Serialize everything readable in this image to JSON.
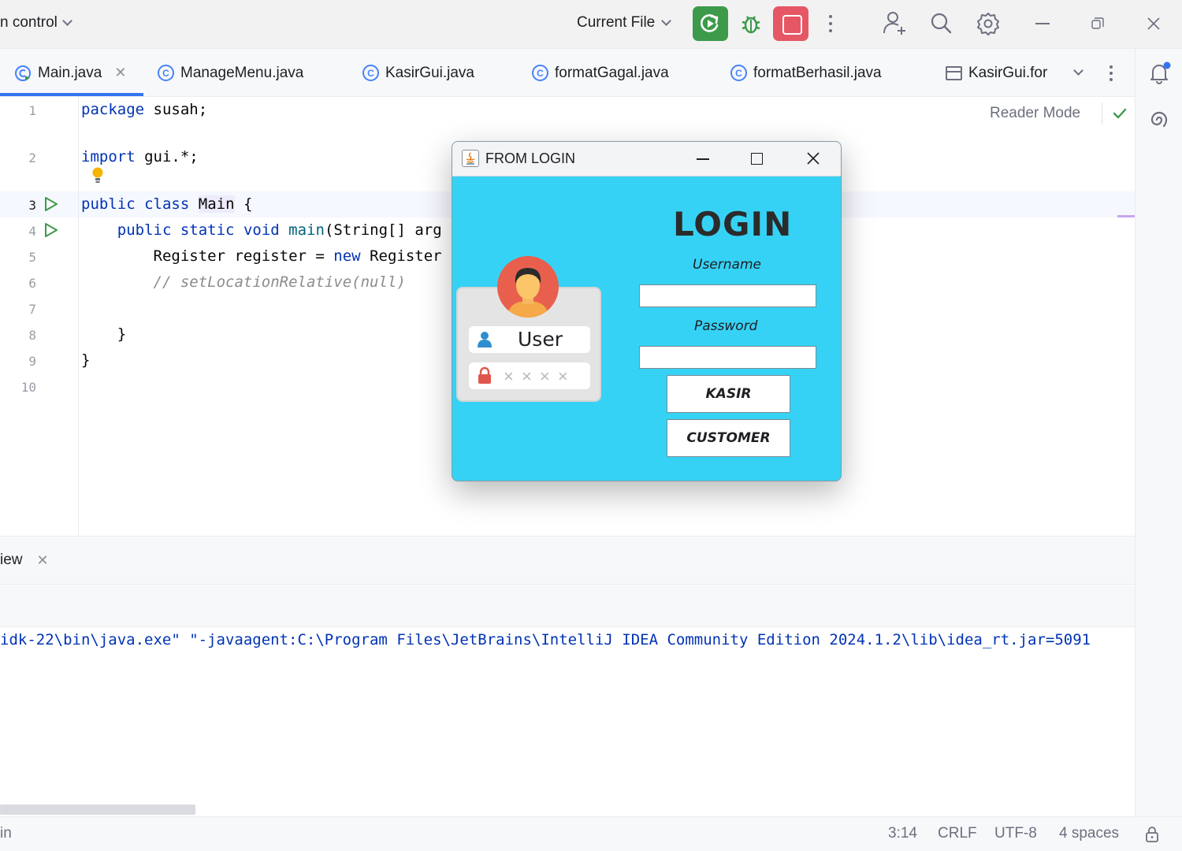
{
  "toolbar": {
    "vcs_label": "n control",
    "run_config": "Current File"
  },
  "tabs": [
    {
      "label": "Main.java",
      "active": true
    },
    {
      "label": "ManageMenu.java"
    },
    {
      "label": "KasirGui.java"
    },
    {
      "label": "formatGagal.java"
    },
    {
      "label": "formatBerhasil.java"
    },
    {
      "label": "KasirGui.for"
    }
  ],
  "editor": {
    "reader_mode": "Reader Mode",
    "line_numbers": [
      "1",
      "2",
      "3",
      "4",
      "5",
      "6",
      "7",
      "8",
      "9",
      "10"
    ],
    "lines": {
      "l1_kw": "package",
      "l1_rest": " susah;",
      "l2_kw": "import",
      "l2_rest": " gui.*;",
      "l3_kw1": "public",
      "l3_kw2": "class",
      "l3_cls": "Main",
      "l3_rest": " {",
      "l4_kw1": "public",
      "l4_kw2": "static",
      "l4_kw3": "void",
      "l4_fn": "main",
      "l4_rest": "(String[] arg",
      "l5_a": "Register register = ",
      "l5_kw": "new",
      "l5_b": " Register",
      "l6_cm": "// setLocationRelative(null)",
      "l8": "}",
      "l9": "}"
    }
  },
  "run_panel": {
    "tab_label": "iew",
    "console": "idk-22\\bin\\java.exe\" \"-javaagent:C:\\Program Files\\JetBrains\\IntelliJ IDEA Community Edition 2024.1.2\\lib\\idea_rt.jar=5091"
  },
  "statusbar": {
    "left": "in",
    "position": "3:14",
    "line_sep": "CRLF",
    "encoding": "UTF-8",
    "indent": "4 spaces"
  },
  "dialog": {
    "title": "FROM LOGIN",
    "heading": "LOGIN",
    "username_label": "Username",
    "password_label": "Password",
    "kasir_button": "KASIR",
    "customer_button": "CUSTOMER",
    "card_user_label": "User",
    "card_password_mask": "× × × ×",
    "bg_color": "#36d2f5"
  }
}
